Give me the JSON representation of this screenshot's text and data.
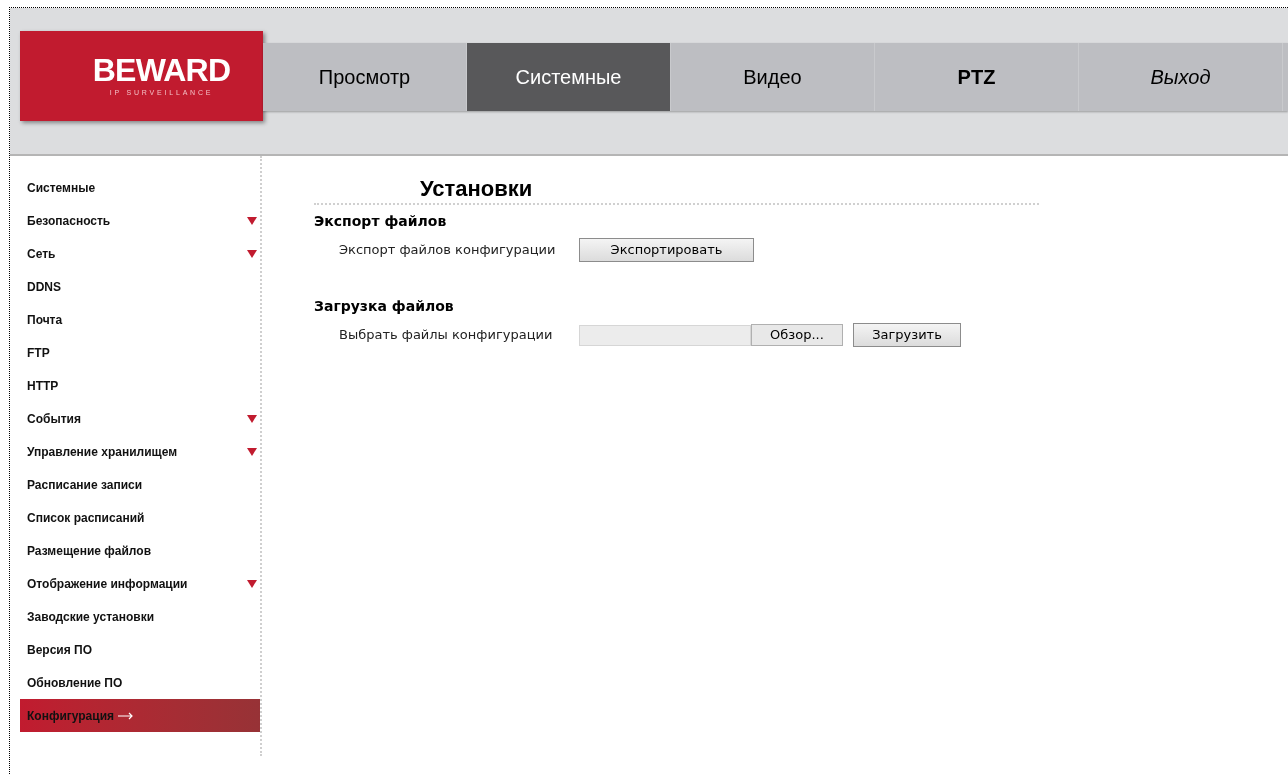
{
  "logo": {
    "name": "BEWARD",
    "tagline": "IP SURVEILLANCE"
  },
  "nav": [
    {
      "label": "Просмотр",
      "selected": false,
      "kind": "plain"
    },
    {
      "label": "Системные",
      "selected": true,
      "kind": "plain"
    },
    {
      "label": "Видео",
      "selected": false,
      "kind": "plain"
    },
    {
      "label": "PTZ",
      "selected": false,
      "kind": "bold"
    },
    {
      "label": "Выход",
      "selected": false,
      "kind": "italic"
    }
  ],
  "sidebar": {
    "items": [
      {
        "label": "Системные",
        "expandable": false,
        "selected": false
      },
      {
        "label": "Безопасность",
        "expandable": true,
        "selected": false
      },
      {
        "label": "Сеть",
        "expandable": true,
        "selected": false
      },
      {
        "label": "DDNS",
        "expandable": false,
        "selected": false
      },
      {
        "label": "Почта",
        "expandable": false,
        "selected": false
      },
      {
        "label": "FTP",
        "expandable": false,
        "selected": false
      },
      {
        "label": "HTTP",
        "expandable": false,
        "selected": false
      },
      {
        "label": "События",
        "expandable": true,
        "selected": false
      },
      {
        "label": "Управление хранилищем",
        "expandable": true,
        "selected": false
      },
      {
        "label": "Расписание записи",
        "expandable": false,
        "selected": false
      },
      {
        "label": "Список расписаний",
        "expandable": false,
        "selected": false
      },
      {
        "label": "Размещение файлов",
        "expandable": false,
        "selected": false
      },
      {
        "label": "Отображение информации",
        "expandable": true,
        "selected": false
      },
      {
        "label": "Заводские установки",
        "expandable": false,
        "selected": false
      },
      {
        "label": "Версия ПО",
        "expandable": false,
        "selected": false
      },
      {
        "label": "Обновление ПО",
        "expandable": false,
        "selected": false
      },
      {
        "label": "Конфигурация",
        "expandable": false,
        "selected": true
      }
    ]
  },
  "page": {
    "title": "Установки",
    "export": {
      "heading": "Экспорт файлов",
      "label": "Экспорт файлов конфигурации",
      "button": "Экспортировать"
    },
    "upload": {
      "heading": "Загрузка файлов",
      "label": "Выбрать файлы конфигурации",
      "browse": "Обзор...",
      "button": "Загрузить"
    }
  }
}
